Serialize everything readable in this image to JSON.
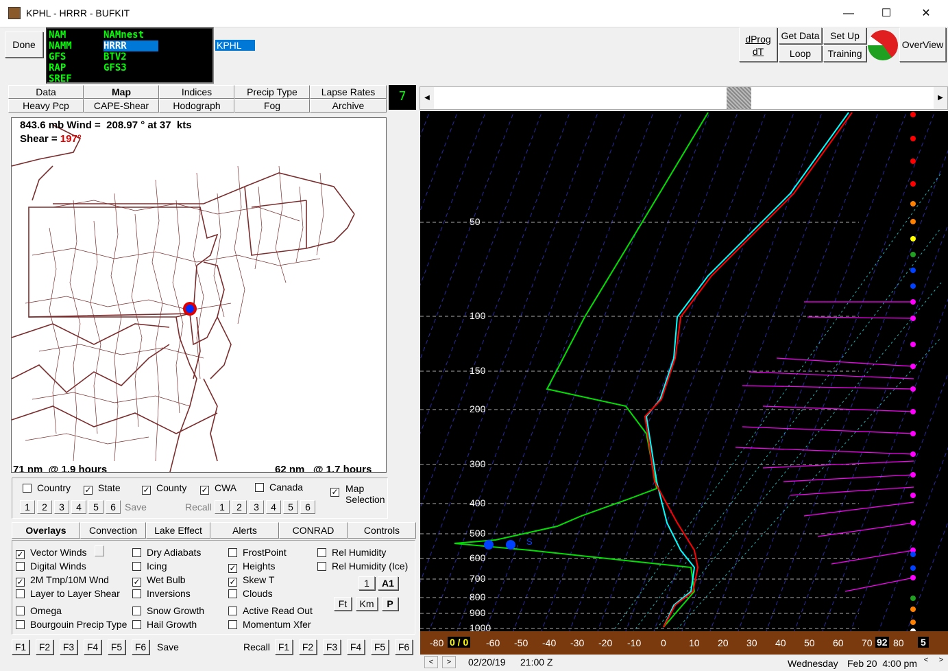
{
  "window": {
    "title": "KPHL - HRRR - BUFKIT",
    "minimize": "—",
    "maximize": "☐",
    "close": "✕"
  },
  "toolbar": {
    "done": "Done",
    "station": "KPHL",
    "dprog_line1": "dProg",
    "dprog_line2": "dT",
    "get_data": "Get Data",
    "set_up": "Set Up",
    "loop": "Loop",
    "training": "Training",
    "overview": "OverView"
  },
  "models": {
    "col1": [
      "NAM",
      "NAMM",
      "GFS",
      "RAP",
      "SREF"
    ],
    "col2": [
      "NAMnest",
      "HRRR",
      "BTV2",
      "GFS3"
    ],
    "selected": "HRRR"
  },
  "tabs": {
    "row1": [
      "Data",
      "Map",
      "Indices",
      "Precip Type",
      "Lapse Rates"
    ],
    "row2": [
      "Heavy Pcp",
      "CAPE-Shear",
      "Hodograph",
      "Fog",
      "Archive"
    ],
    "active": "Map"
  },
  "counter": "7",
  "map": {
    "wind_text": "843.6 mb Wind =  208.97 ° at 37  kts",
    "shear_label": "Shear = ",
    "shear_value": "197°",
    "left_bottom": "71 nm  @ 1.9 hours",
    "right_bottom": "62 nm   @ 1.7 hours"
  },
  "map_opts": {
    "checks": [
      {
        "label": "Country",
        "checked": false
      },
      {
        "label": "State",
        "checked": true
      },
      {
        "label": "County",
        "checked": true
      },
      {
        "label": "CWA",
        "checked": true
      },
      {
        "label": "Canada",
        "checked": false
      }
    ],
    "map_selection_line1": "Map",
    "map_selection_line2": "Selection",
    "save": "Save",
    "recall": "Recall",
    "nums": [
      "1",
      "2",
      "3",
      "4",
      "5",
      "6"
    ]
  },
  "sub_tabs": [
    "Overlays",
    "Convection",
    "Lake Effect",
    "Alerts",
    "CONRAD",
    "Controls"
  ],
  "overlays": {
    "col1": [
      {
        "label": "Vector Winds",
        "checked": true
      },
      {
        "label": "Digital Winds",
        "checked": false
      },
      {
        "label": "2M Tmp/10M Wnd",
        "checked": true
      },
      {
        "label": "Layer to Layer Shear",
        "checked": false
      },
      {
        "label": "Omega",
        "checked": false
      },
      {
        "label": "Bourgouin Precip Type",
        "checked": false
      }
    ],
    "col2": [
      {
        "label": "Dry Adiabats",
        "checked": false
      },
      {
        "label": "Icing",
        "checked": false
      },
      {
        "label": "Wet Bulb",
        "checked": true
      },
      {
        "label": "Inversions",
        "checked": false
      },
      {
        "label": "Snow Growth",
        "checked": false
      },
      {
        "label": "Hail Growth",
        "checked": false
      }
    ],
    "col3": [
      {
        "label": "FrostPoint",
        "checked": false
      },
      {
        "label": "Heights",
        "checked": true
      },
      {
        "label": "Skew T",
        "checked": true
      },
      {
        "label": "Clouds",
        "checked": false
      },
      {
        "label": "Active Read Out",
        "checked": false
      },
      {
        "label": "Momentum Xfer",
        "checked": false
      }
    ],
    "col4": [
      {
        "label": "Rel Humidity",
        "checked": false
      },
      {
        "label": "Rel Humidity (Ice)",
        "checked": false
      }
    ],
    "btn_1": "1",
    "btn_a1": "A1",
    "btn_ft": "Ft",
    "btn_km": "Km",
    "btn_p": "P"
  },
  "fkeys": {
    "keys": [
      "F1",
      "F2",
      "F3",
      "F4",
      "F5",
      "F6"
    ],
    "save": "Save",
    "recall": "Recall"
  },
  "skewt": {
    "pressure_labels": [
      "50",
      "100",
      "150",
      "200",
      "300",
      "400",
      "500",
      "600",
      "700",
      "800",
      "900",
      "1000"
    ],
    "temp_labels": [
      "-80",
      "-60",
      "-50",
      "-40",
      "-30",
      "-20",
      "-10",
      "0",
      "10",
      "20",
      "30",
      "40",
      "50",
      "60",
      "70",
      "80"
    ],
    "readout_left": "0 / 0",
    "readout_right": "92",
    "readout_5": "5",
    "s_label": "S"
  },
  "status": {
    "date": "02/20/19",
    "time": "21:00 Z",
    "day": "Wednesday",
    "local": "Feb 20  4:00 pm"
  },
  "colors": {
    "temp": "#ff0000",
    "dewpoint_green": "#00e000",
    "wetbulb": "#00ffff",
    "wind": "#ff00ff",
    "bg": "#000000",
    "bottom_bar": "#7a3a0e"
  }
}
